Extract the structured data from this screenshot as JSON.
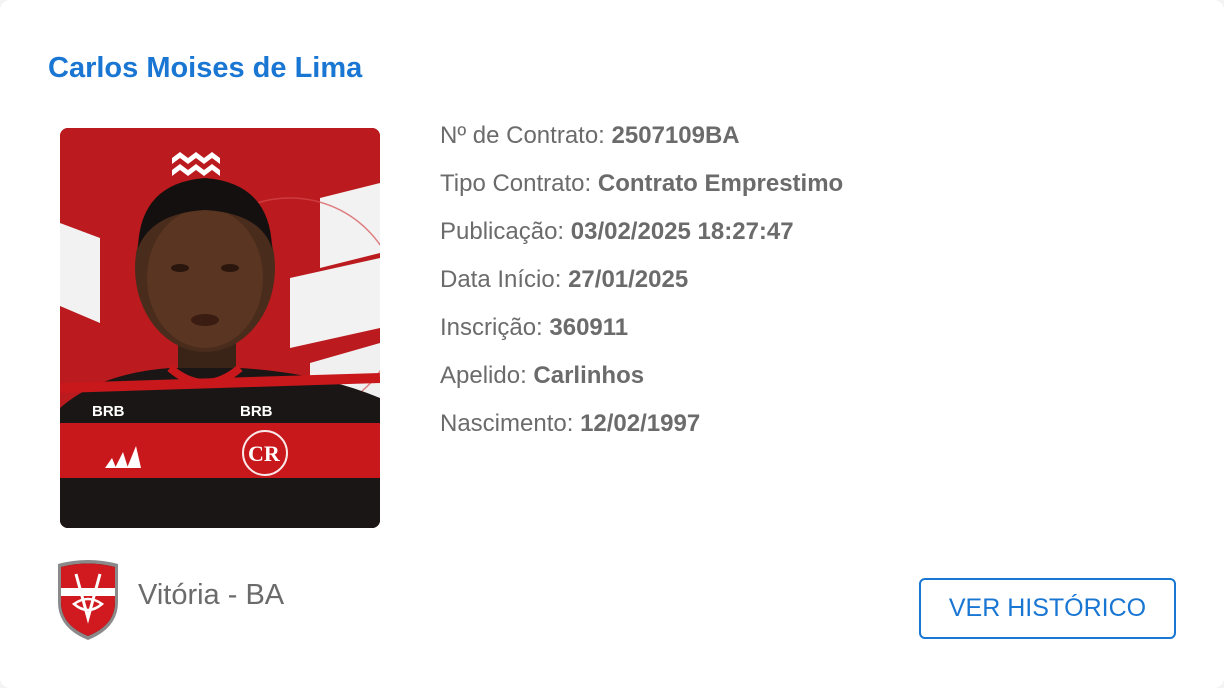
{
  "player": {
    "name": "Carlos Moises de Lima"
  },
  "photo": {
    "icon": "player-photo",
    "sponsor_left": "BRB",
    "sponsor_right": "BRB",
    "crest_text": "CR"
  },
  "details": [
    {
      "label": "Nº de Contrato:",
      "value": "2507109BA"
    },
    {
      "label": "Tipo Contrato:",
      "value": "Contrato Emprestimo"
    },
    {
      "label": "Publicação:",
      "value": "03/02/2025 18:27:47"
    },
    {
      "label": "Data Início:",
      "value": "27/01/2025"
    },
    {
      "label": "Inscrição:",
      "value": "360911"
    },
    {
      "label": "Apelido:",
      "value": "Carlinhos"
    },
    {
      "label": "Nascimento:",
      "value": "12/02/1997"
    }
  ],
  "club": {
    "name": "Vitória - BA",
    "icon": "club-shield-icon"
  },
  "actions": {
    "history_label": "VER HISTÓRICO"
  },
  "colors": {
    "accent": "#1976d2",
    "text": "#6b6b6b",
    "photo_red": "#b8161a"
  }
}
